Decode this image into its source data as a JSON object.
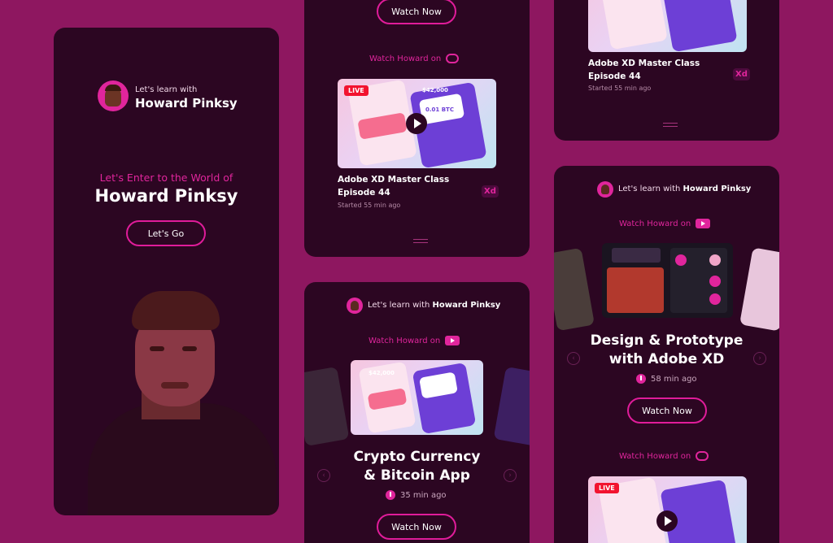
{
  "hero": {
    "learn_prefix": "Let's learn with",
    "name": "Howard Pinksy",
    "tagline": "Let's Enter to the World of",
    "headline": "Howard Pinksy",
    "cta": "Let's Go"
  },
  "card_top_middle": {
    "watch_now": "Watch Now",
    "watch_on": "Watch Howard on",
    "platform_icon": "creative-cloud-icon",
    "live_badge": "LIVE",
    "thumb_price": "$42,000",
    "thumb_btc": "0.01 BTC",
    "title_line1": "Adobe XD Master Class",
    "title_line2": "Episode 44",
    "started": "Started 55 min ago",
    "app_badge": "Xd"
  },
  "card_bottom_middle": {
    "learn_prefix": "Let's learn with",
    "name": "Howard Pinksy",
    "watch_on": "Watch Howard on",
    "platform_icon": "youtube-icon",
    "thumb_price": "$42,000",
    "title_line1": "Crypto Currency",
    "title_line2": "& Bitcoin App",
    "time": "35 min ago",
    "watch_now": "Watch Now"
  },
  "card_top_right": {
    "title_line1": "Adobe XD Master Class",
    "title_line2": "Episode 44",
    "started": "Started 55 min ago",
    "app_badge": "Xd"
  },
  "card_bottom_right": {
    "learn_prefix": "Let's learn with",
    "name": "Howard Pinksy",
    "watch_on": "Watch Howard on",
    "platform_icon": "youtube-icon",
    "title_line1": "Design & Prototype",
    "title_line2": "with Adobe XD",
    "time": "58 min ago",
    "watch_now": "Watch Now",
    "watch_on_2": "Watch Howard on",
    "platform_icon_2": "creative-cloud-icon",
    "live_badge": "LIVE"
  },
  "colors": {
    "background": "#8e1760",
    "card": "#2c0622",
    "accent": "#e0259c",
    "live": "#f2132f"
  }
}
